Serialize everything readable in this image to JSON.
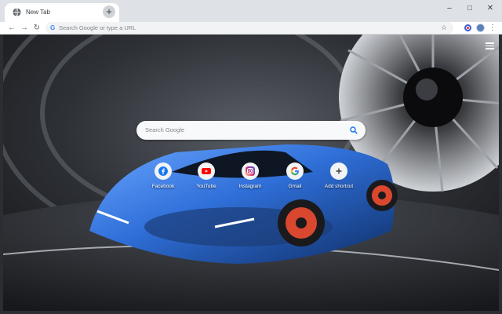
{
  "browser": {
    "tab": {
      "title": "New Tab",
      "close_glyph": "×"
    },
    "new_tab_glyph": "+",
    "window_controls": {
      "minimize": "–",
      "maximize": "□",
      "close": "✕"
    },
    "nav": {
      "back": "←",
      "forward": "→",
      "reload": "↻"
    },
    "omnibox": {
      "g_glyph": "G",
      "placeholder": "Search Google or type a URL",
      "bookmark_glyph": "☆"
    },
    "menu_glyph": "⋮"
  },
  "newtab": {
    "search": {
      "placeholder": "Search Google"
    },
    "shortcuts": [
      {
        "label": "Facebook",
        "icon": "facebook-icon",
        "color": "#1877f2"
      },
      {
        "label": "YouTube",
        "icon": "youtube-icon",
        "color": "#ff0000"
      },
      {
        "label": "Instagram",
        "icon": "instagram-icon",
        "color": "#c13584"
      },
      {
        "label": "Gmail",
        "icon": "google-icon",
        "color": "#4285f4"
      },
      {
        "label": "Add shortcut",
        "icon": "plus-icon",
        "color": "#3c4043"
      }
    ]
  },
  "colors": {
    "tabstrip": "#dee1e6",
    "car_blue": "#2f6fd8",
    "wheel_red": "#d9472f",
    "accent_blue": "#1a73e8"
  }
}
